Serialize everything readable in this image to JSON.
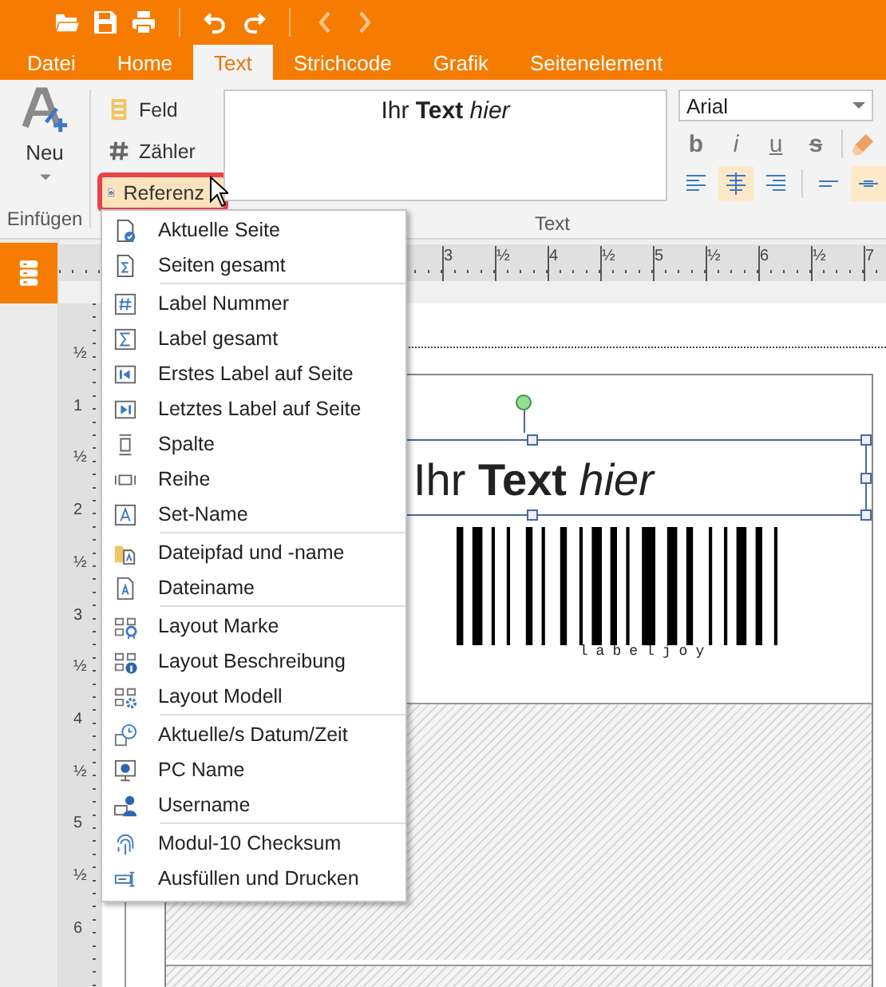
{
  "tabs": [
    {
      "label": "Datei",
      "selected": false
    },
    {
      "label": "Home",
      "selected": false
    },
    {
      "label": "Text",
      "selected": true
    },
    {
      "label": "Strichcode",
      "selected": false
    },
    {
      "label": "Grafik",
      "selected": false
    },
    {
      "label": "Seitenelement",
      "selected": false
    }
  ],
  "ribbon": {
    "new_button": "Neu",
    "insert_group_label": "Einfügen",
    "insert_buttons": [
      {
        "label": "Feld",
        "kind": "field",
        "highlighted": false
      },
      {
        "label": "Zähler",
        "kind": "counter",
        "highlighted": false
      },
      {
        "label": "Referenz",
        "kind": "reference",
        "highlighted": true
      }
    ],
    "text_preview": "Ihr **Text** *hier*",
    "text_group_label": "Text",
    "font": "Arial",
    "format_buttons": [
      {
        "label": "b",
        "kind": "bold"
      },
      {
        "label": "i",
        "kind": "italic"
      },
      {
        "label": "u",
        "kind": "underline"
      },
      {
        "label": "s",
        "kind": "strike"
      }
    ],
    "alignment": [
      {
        "kind": "left",
        "selected": false
      },
      {
        "kind": "center",
        "selected": true
      },
      {
        "kind": "right",
        "selected": false
      }
    ],
    "vertical_alignment": [
      {
        "kind": "top",
        "selected": false
      },
      {
        "kind": "middle",
        "selected": true
      }
    ]
  },
  "ruler": {
    "horizontal_labels": [
      "3",
      "½",
      "4",
      "½",
      "5",
      "½",
      "6",
      "½",
      "7"
    ],
    "vertical_labels": [
      "½",
      "1",
      "½",
      "2",
      "½",
      "3",
      "½",
      "4",
      "½",
      "5",
      "½",
      "6"
    ]
  },
  "canvas": {
    "text_object": "Ihr **Text** *hier*",
    "barcode_text": "labeljoy"
  },
  "reference_menu": [
    [
      {
        "label": "Aktuelle Seite",
        "kind": "page_check"
      },
      {
        "label": "Seiten gesamt",
        "kind": "page_sigma"
      }
    ],
    [
      {
        "label": "Label Nummer",
        "kind": "hash"
      },
      {
        "label": "Label gesamt",
        "kind": "sigma"
      },
      {
        "label": "Erstes Label auf Seite",
        "kind": "first"
      },
      {
        "label": "Letztes Label auf Seite",
        "kind": "last"
      },
      {
        "label": "Spalte",
        "kind": "column"
      },
      {
        "label": "Reihe",
        "kind": "row"
      },
      {
        "label": "Set-Name",
        "kind": "letter"
      }
    ],
    [
      {
        "label": "Dateipfad und -name",
        "kind": "folder_file"
      },
      {
        "label": "Dateiname",
        "kind": "file"
      }
    ],
    [
      {
        "label": "Layout Marke",
        "kind": "layout_mark"
      },
      {
        "label": "Layout Beschreibung",
        "kind": "layout_info"
      },
      {
        "label": "Layout Modell",
        "kind": "layout_model"
      }
    ],
    [
      {
        "label": "Aktuelle/s Datum/Zeit",
        "kind": "clock"
      },
      {
        "label": "PC Name",
        "kind": "monitor"
      },
      {
        "label": "Username",
        "kind": "user"
      }
    ],
    [
      {
        "label": "Modul-10 Checksum",
        "kind": "fingerprint"
      },
      {
        "label": "Ausfüllen und Drucken",
        "kind": "fill_print"
      }
    ]
  ]
}
